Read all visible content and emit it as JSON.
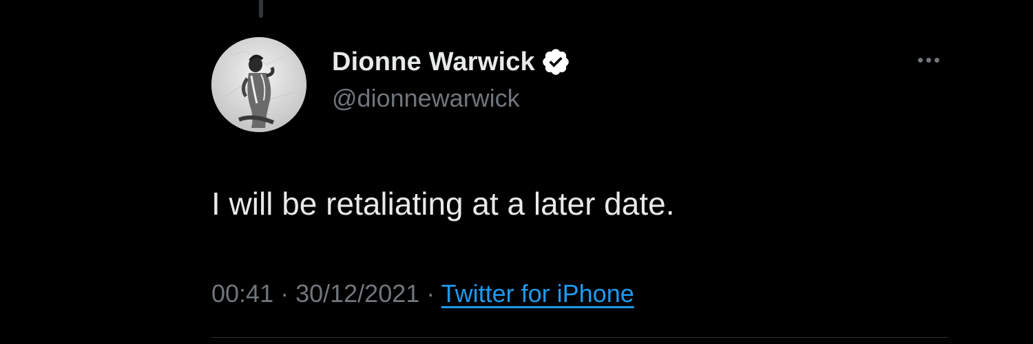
{
  "tweet": {
    "author": {
      "display_name": "Dionne Warwick",
      "handle": "@dionnewarwick",
      "verified": true
    },
    "text": "I will be retaliating at a later date.",
    "meta": {
      "time": "00:41",
      "separator": " · ",
      "date": "30/12/2021",
      "source": "Twitter for iPhone"
    }
  },
  "icons": {
    "verified": "verified-badge-icon",
    "more": "more-horizontal-icon",
    "avatar": "profile-photo"
  },
  "colors": {
    "background": "#000000",
    "primary_text": "#e7e9ea",
    "secondary_text": "#71767b",
    "link": "#1d9bf0",
    "divider": "#2f3336"
  }
}
